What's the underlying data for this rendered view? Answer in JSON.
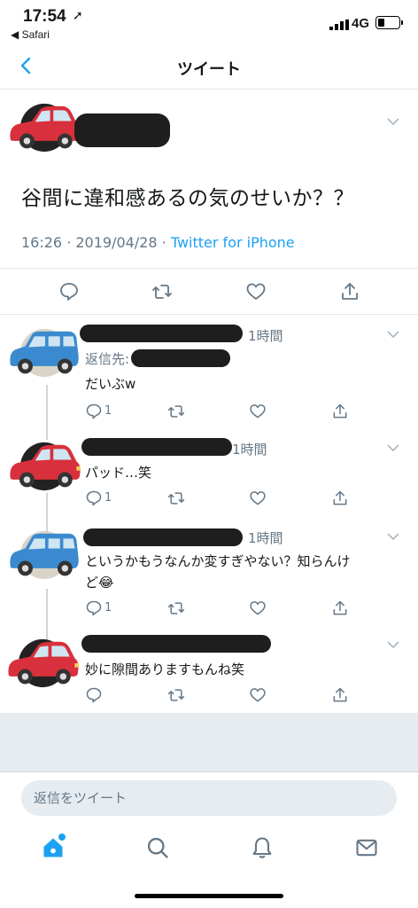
{
  "status_bar": {
    "time": "17:54",
    "back_app": "◀ Safari",
    "network": "4G"
  },
  "header": {
    "title": "ツイート"
  },
  "main_tweet": {
    "text": "谷間に違和感あるの気のせいか？？",
    "timestamp": "16:26 · 2019/04/28 · ",
    "source": "Twitter for iPhone"
  },
  "replies": [
    {
      "time": "1時間",
      "reply_to_label": "返信先:",
      "text": "だいぶw",
      "reply_count": "1",
      "avatar_color": "#3b8ad0"
    },
    {
      "time": "1時間",
      "text": "パッド…笑",
      "reply_count": "1",
      "avatar_color": "#d8303c"
    },
    {
      "time": "1時間",
      "text_line1": "というかもうなんか変すぎやない？知らんけ",
      "text_line2": "ど😂",
      "reply_count": "1",
      "avatar_color": "#3b8ad0"
    },
    {
      "text": "妙に隙間ありますもんね笑",
      "avatar_color": "#d8303c"
    }
  ],
  "reply_box": {
    "placeholder": "返信をツイート"
  },
  "tab_bar": {
    "items": [
      "home",
      "search",
      "notifications",
      "messages"
    ]
  },
  "colors": {
    "accent": "#1da1f2",
    "muted": "#657786",
    "car_red": "#d8303c",
    "car_blue": "#3b8ad0"
  }
}
